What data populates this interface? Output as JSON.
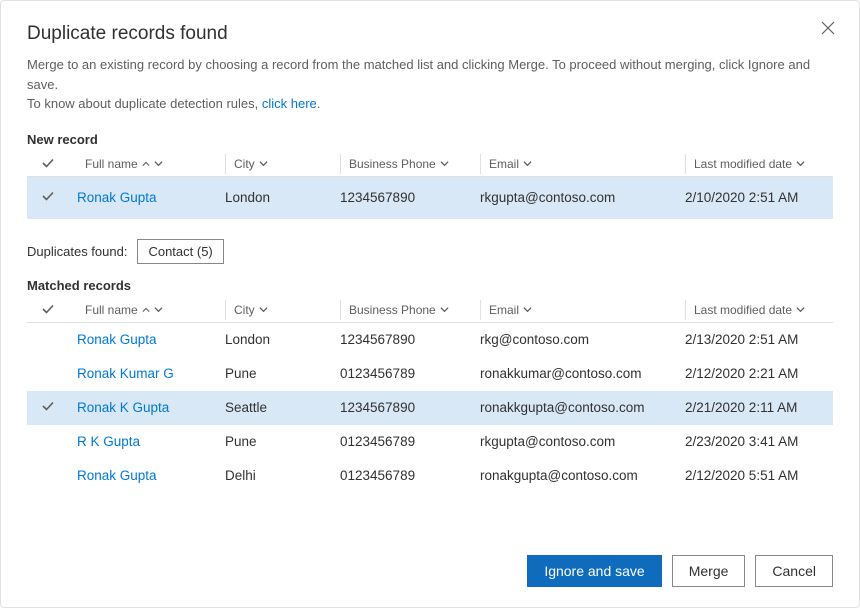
{
  "dialog": {
    "title": "Duplicate records found",
    "description_part1": "Merge to an existing record by choosing a record from the matched list and clicking Merge. To proceed without merging, click Ignore and save.",
    "description_part2": "To know about duplicate detection rules, ",
    "description_link": "click here"
  },
  "sections": {
    "new_record_label": "New record",
    "matched_records_label": "Matched records",
    "duplicates_found_label": "Duplicates found:",
    "duplicates_found_value": "Contact (5)"
  },
  "columns": {
    "full_name": "Full name",
    "city": "City",
    "business_phone": "Business Phone",
    "email": "Email",
    "last_modified": "Last modified date"
  },
  "new_record": {
    "name": "Ronak Gupta",
    "city": "London",
    "phone": "1234567890",
    "email": "rkgupta@contoso.com",
    "modified": "2/10/2020 2:51 AM",
    "selected": true
  },
  "matched": [
    {
      "name": "Ronak Gupta",
      "city": "London",
      "phone": "1234567890",
      "email": "rkg@contoso.com",
      "modified": "2/13/2020 2:51 AM",
      "selected": false
    },
    {
      "name": "Ronak Kumar G",
      "city": "Pune",
      "phone": "0123456789",
      "email": "ronakkumar@contoso.com",
      "modified": "2/12/2020 2:21 AM",
      "selected": false
    },
    {
      "name": "Ronak K Gupta",
      "city": "Seattle",
      "phone": "1234567890",
      "email": "ronakkgupta@contoso.com",
      "modified": "2/21/2020 2:11 AM",
      "selected": true
    },
    {
      "name": "R K Gupta",
      "city": "Pune",
      "phone": "0123456789",
      "email": "rkgupta@contoso.com",
      "modified": "2/23/2020 3:41 AM",
      "selected": false
    },
    {
      "name": "Ronak Gupta",
      "city": "Delhi",
      "phone": "0123456789",
      "email": "ronakgupta@contoso.com",
      "modified": "2/12/2020 5:51 AM",
      "selected": false
    }
  ],
  "buttons": {
    "ignore": "Ignore and save",
    "merge": "Merge",
    "cancel": "Cancel"
  }
}
